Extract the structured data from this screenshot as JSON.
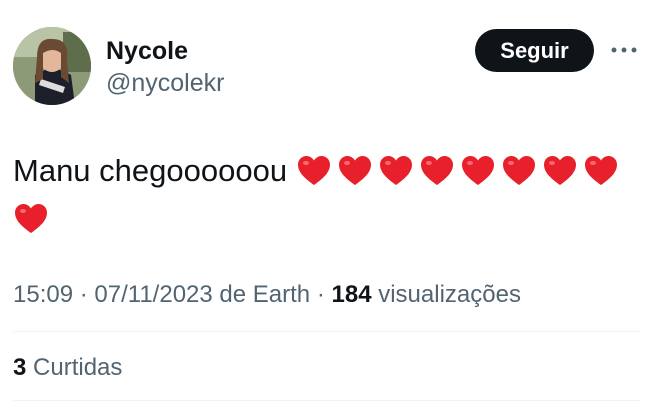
{
  "author": {
    "display_name": "Nycole",
    "handle": "@nycolekr"
  },
  "header": {
    "follow_label": "Seguir",
    "more_icon": "ellipsis-icon"
  },
  "tweet": {
    "text": "Manu chegoooooou",
    "hearts": [
      "heart",
      "heart",
      "heart",
      "heart",
      "heart",
      "heart",
      "heart",
      "heart",
      "heart"
    ],
    "heart_color": "#e8202c"
  },
  "meta": {
    "time": "15:09",
    "separator": "·",
    "date": "07/11/2023",
    "source": "de Earth",
    "views_count": "184",
    "views_label": "visualizações"
  },
  "stats": {
    "likes_count": "3",
    "likes_label": "Curtidas"
  },
  "colors": {
    "text": "#0f1419",
    "secondary": "#536471",
    "button_bg": "#0f1419",
    "divider": "#eff3f4"
  }
}
